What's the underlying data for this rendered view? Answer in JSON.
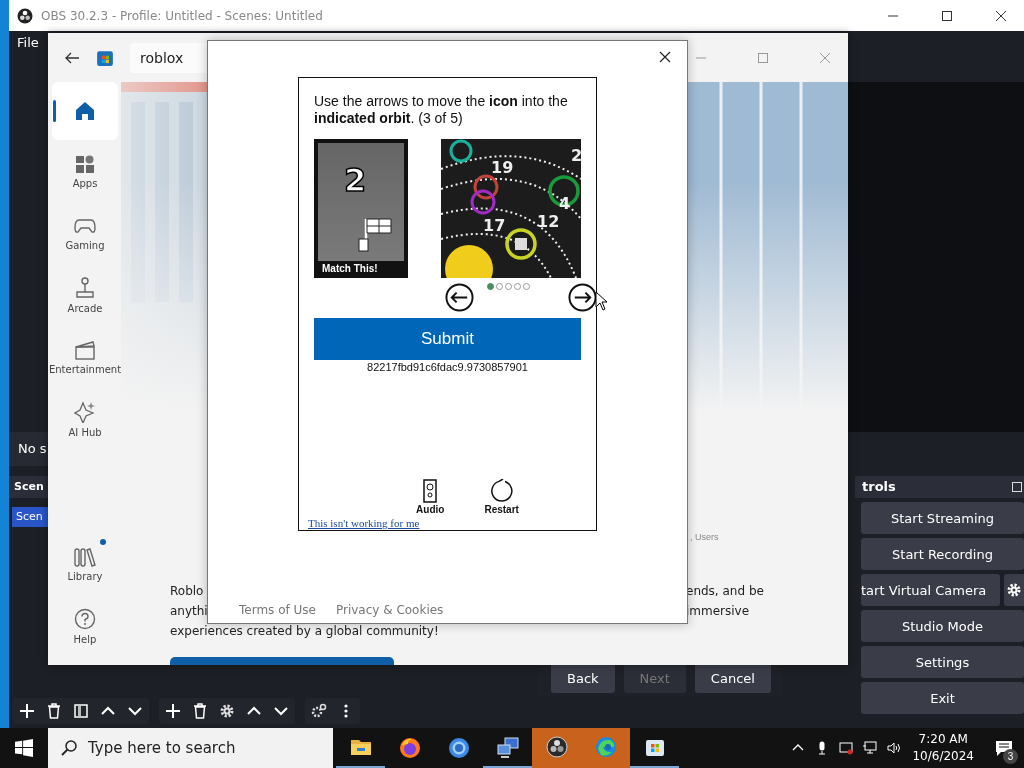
{
  "obs": {
    "title": "OBS 30.2.3 - Profile: Untitled - Scenes: Untitled",
    "menu": [
      "File"
    ],
    "preview_label": "No s",
    "scenes": {
      "title": "Scen",
      "items": [
        {
          "label": "Scen",
          "selected": true
        }
      ]
    },
    "controls": {
      "title": "trols",
      "buttons": [
        {
          "label": "Start Streaming",
          "kind": "plain"
        },
        {
          "label": "Start Recording",
          "kind": "plain"
        },
        {
          "label": "tart Virtual Camera",
          "kind": "with_gear"
        },
        {
          "label": "Studio Mode",
          "kind": "plain"
        },
        {
          "label": "Settings",
          "kind": "plain"
        },
        {
          "label": "Exit",
          "kind": "plain"
        }
      ]
    },
    "wizard_buttons": [
      {
        "label": "Back",
        "disabled": false
      },
      {
        "label": "Next",
        "disabled": true
      },
      {
        "label": "Cancel",
        "disabled": false
      }
    ]
  },
  "store": {
    "search": {
      "value": "roblox"
    },
    "nav": [
      {
        "kind": "home",
        "selected": true
      },
      {
        "kind": "apps",
        "label": "Apps",
        "selected": false
      },
      {
        "kind": "gaming",
        "label": "Gaming",
        "selected": false
      },
      {
        "kind": "arcade",
        "label": "Arcade",
        "selected": false
      },
      {
        "kind": "entertainment",
        "label": "Entertainment",
        "selected": false
      },
      {
        "kind": "aihub",
        "label": "AI Hub",
        "selected": false
      },
      {
        "kind": "library",
        "label": "Library",
        "selected": false,
        "badge": true
      },
      {
        "kind": "help",
        "label": "Help",
        "selected": false
      }
    ],
    "hero": {
      "kind": "picture"
    },
    "stats_fragment": ", Users",
    "description_left": [
      "Roblo",
      "anythi",
      "experiences created by a global community!"
    ],
    "description_right": [
      "ends, and be",
      "immersive"
    ]
  },
  "dialog": {
    "captcha": {
      "instruction": "Use the arrows to move the **icon** into the **indicated orbit**. (3 of 5)",
      "target_number": "2",
      "target_caption": "Match This!",
      "orbit_labels": [
        "19",
        "17",
        "12",
        "2",
        "4"
      ],
      "pager": [
        {
          "selected": true
        },
        {
          "selected": false
        },
        {
          "selected": false
        },
        {
          "selected": false
        },
        {
          "selected": false
        }
      ],
      "submit": "Submit",
      "session_id": "82217fbd91c6fdac9.9730857901",
      "audio": "Audio",
      "restart": "Restart",
      "help_link": "This isn't working for me"
    },
    "footer_links": [
      "Terms of Use",
      "Privacy & Cookies"
    ]
  },
  "taskbar": {
    "search_placeholder": "Type here to search",
    "apps": [
      {
        "kind": "explorer",
        "highlighted": false,
        "open": true
      },
      {
        "kind": "firefox",
        "highlighted": false,
        "open": false
      },
      {
        "kind": "chrome",
        "highlighted": false,
        "open": false
      },
      {
        "kind": "network",
        "highlighted": false,
        "open": true
      },
      {
        "kind": "obs",
        "highlighted": true,
        "open": true
      },
      {
        "kind": "edge",
        "highlighted": true,
        "open": true
      },
      {
        "kind": "store",
        "highlighted": false,
        "open": true
      }
    ],
    "time": "7:20 AM",
    "date": "10/6/2024",
    "notifications": "3"
  }
}
